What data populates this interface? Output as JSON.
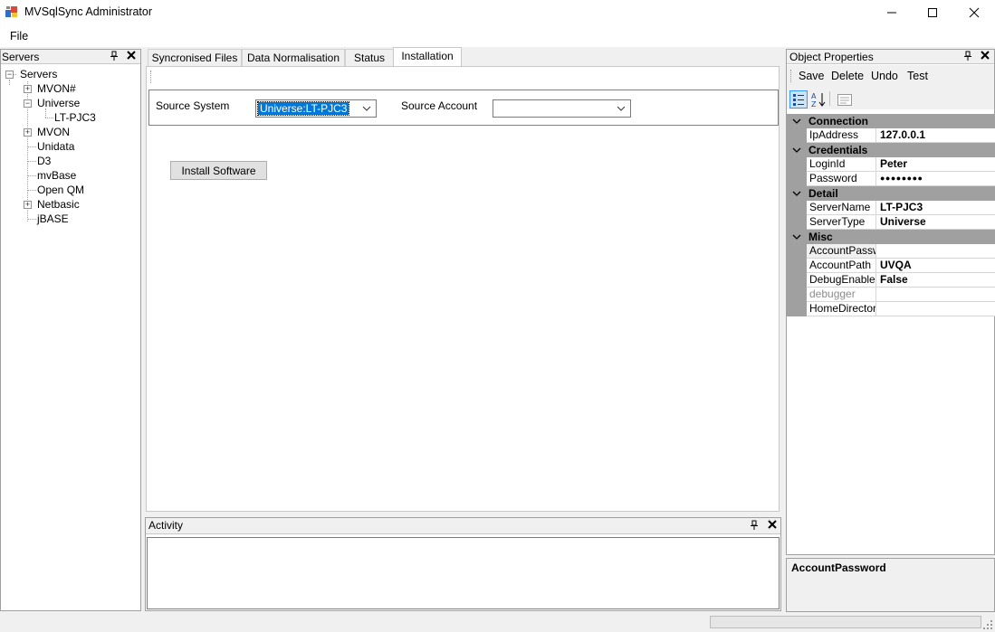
{
  "window": {
    "title": "MVSqlSync Administrator",
    "min_glyph": "—",
    "max_glyph": "☐",
    "close_glyph": "✕"
  },
  "menu": {
    "file": "File"
  },
  "servers_panel": {
    "title": "Servers",
    "root": "Servers",
    "items": [
      {
        "label": "MVON#",
        "expander": "+"
      },
      {
        "label": "Universe",
        "expander": "−"
      },
      {
        "label": "LT-PJC3",
        "expander": ""
      },
      {
        "label": "MVON",
        "expander": "+"
      },
      {
        "label": "Unidata",
        "expander": ""
      },
      {
        "label": "D3",
        "expander": ""
      },
      {
        "label": "mvBase",
        "expander": ""
      },
      {
        "label": "Open QM",
        "expander": ""
      },
      {
        "label": "Netbasic",
        "expander": "+"
      },
      {
        "label": "jBASE",
        "expander": ""
      }
    ]
  },
  "tabs": [
    {
      "label": "Syncronised Files"
    },
    {
      "label": "Data Normalisation"
    },
    {
      "label": "Status"
    },
    {
      "label": "Installation",
      "active": true
    }
  ],
  "installation": {
    "source_system_label": "Source System",
    "source_system_value": "Universe:LT-PJC3",
    "source_account_label": "Source Account",
    "source_account_value": "",
    "install_button": "Install Software"
  },
  "activity_panel": {
    "title": "Activity"
  },
  "props_panel": {
    "title": "Object Properties",
    "toolbar": {
      "save": "Save",
      "delete": "Delete",
      "undo": "Undo",
      "test": "Test"
    },
    "categories": {
      "connection": "Connection",
      "credentials": "Credentials",
      "detail": "Detail",
      "misc": "Misc"
    },
    "props": {
      "ip_name": "IpAddress",
      "ip_value": "127.0.0.1",
      "login_name": "LoginId",
      "login_value": "Peter",
      "password_name": "Password",
      "password_value": "●●●●●●●●",
      "servername_name": "ServerName",
      "servername_value": "LT-PJC3",
      "servertype_name": "ServerType",
      "servertype_value": "Universe",
      "accountpassword_name": "AccountPassword",
      "accountpassword_value": "",
      "accountpath_name": "AccountPath",
      "accountpath_value": "UVQA",
      "debugenabled_name": "DebugEnabled",
      "debugenabled_value": "False",
      "debugger_name": "debugger",
      "debugger_value": "",
      "homedir_name": "HomeDirectory",
      "homedir_value": ""
    },
    "description_title": "AccountPassword"
  },
  "icons": {
    "pin": "🖈",
    "close": "✕"
  },
  "colors": {
    "selection": "#0078d7",
    "category_bg": "#a0a0a0"
  }
}
